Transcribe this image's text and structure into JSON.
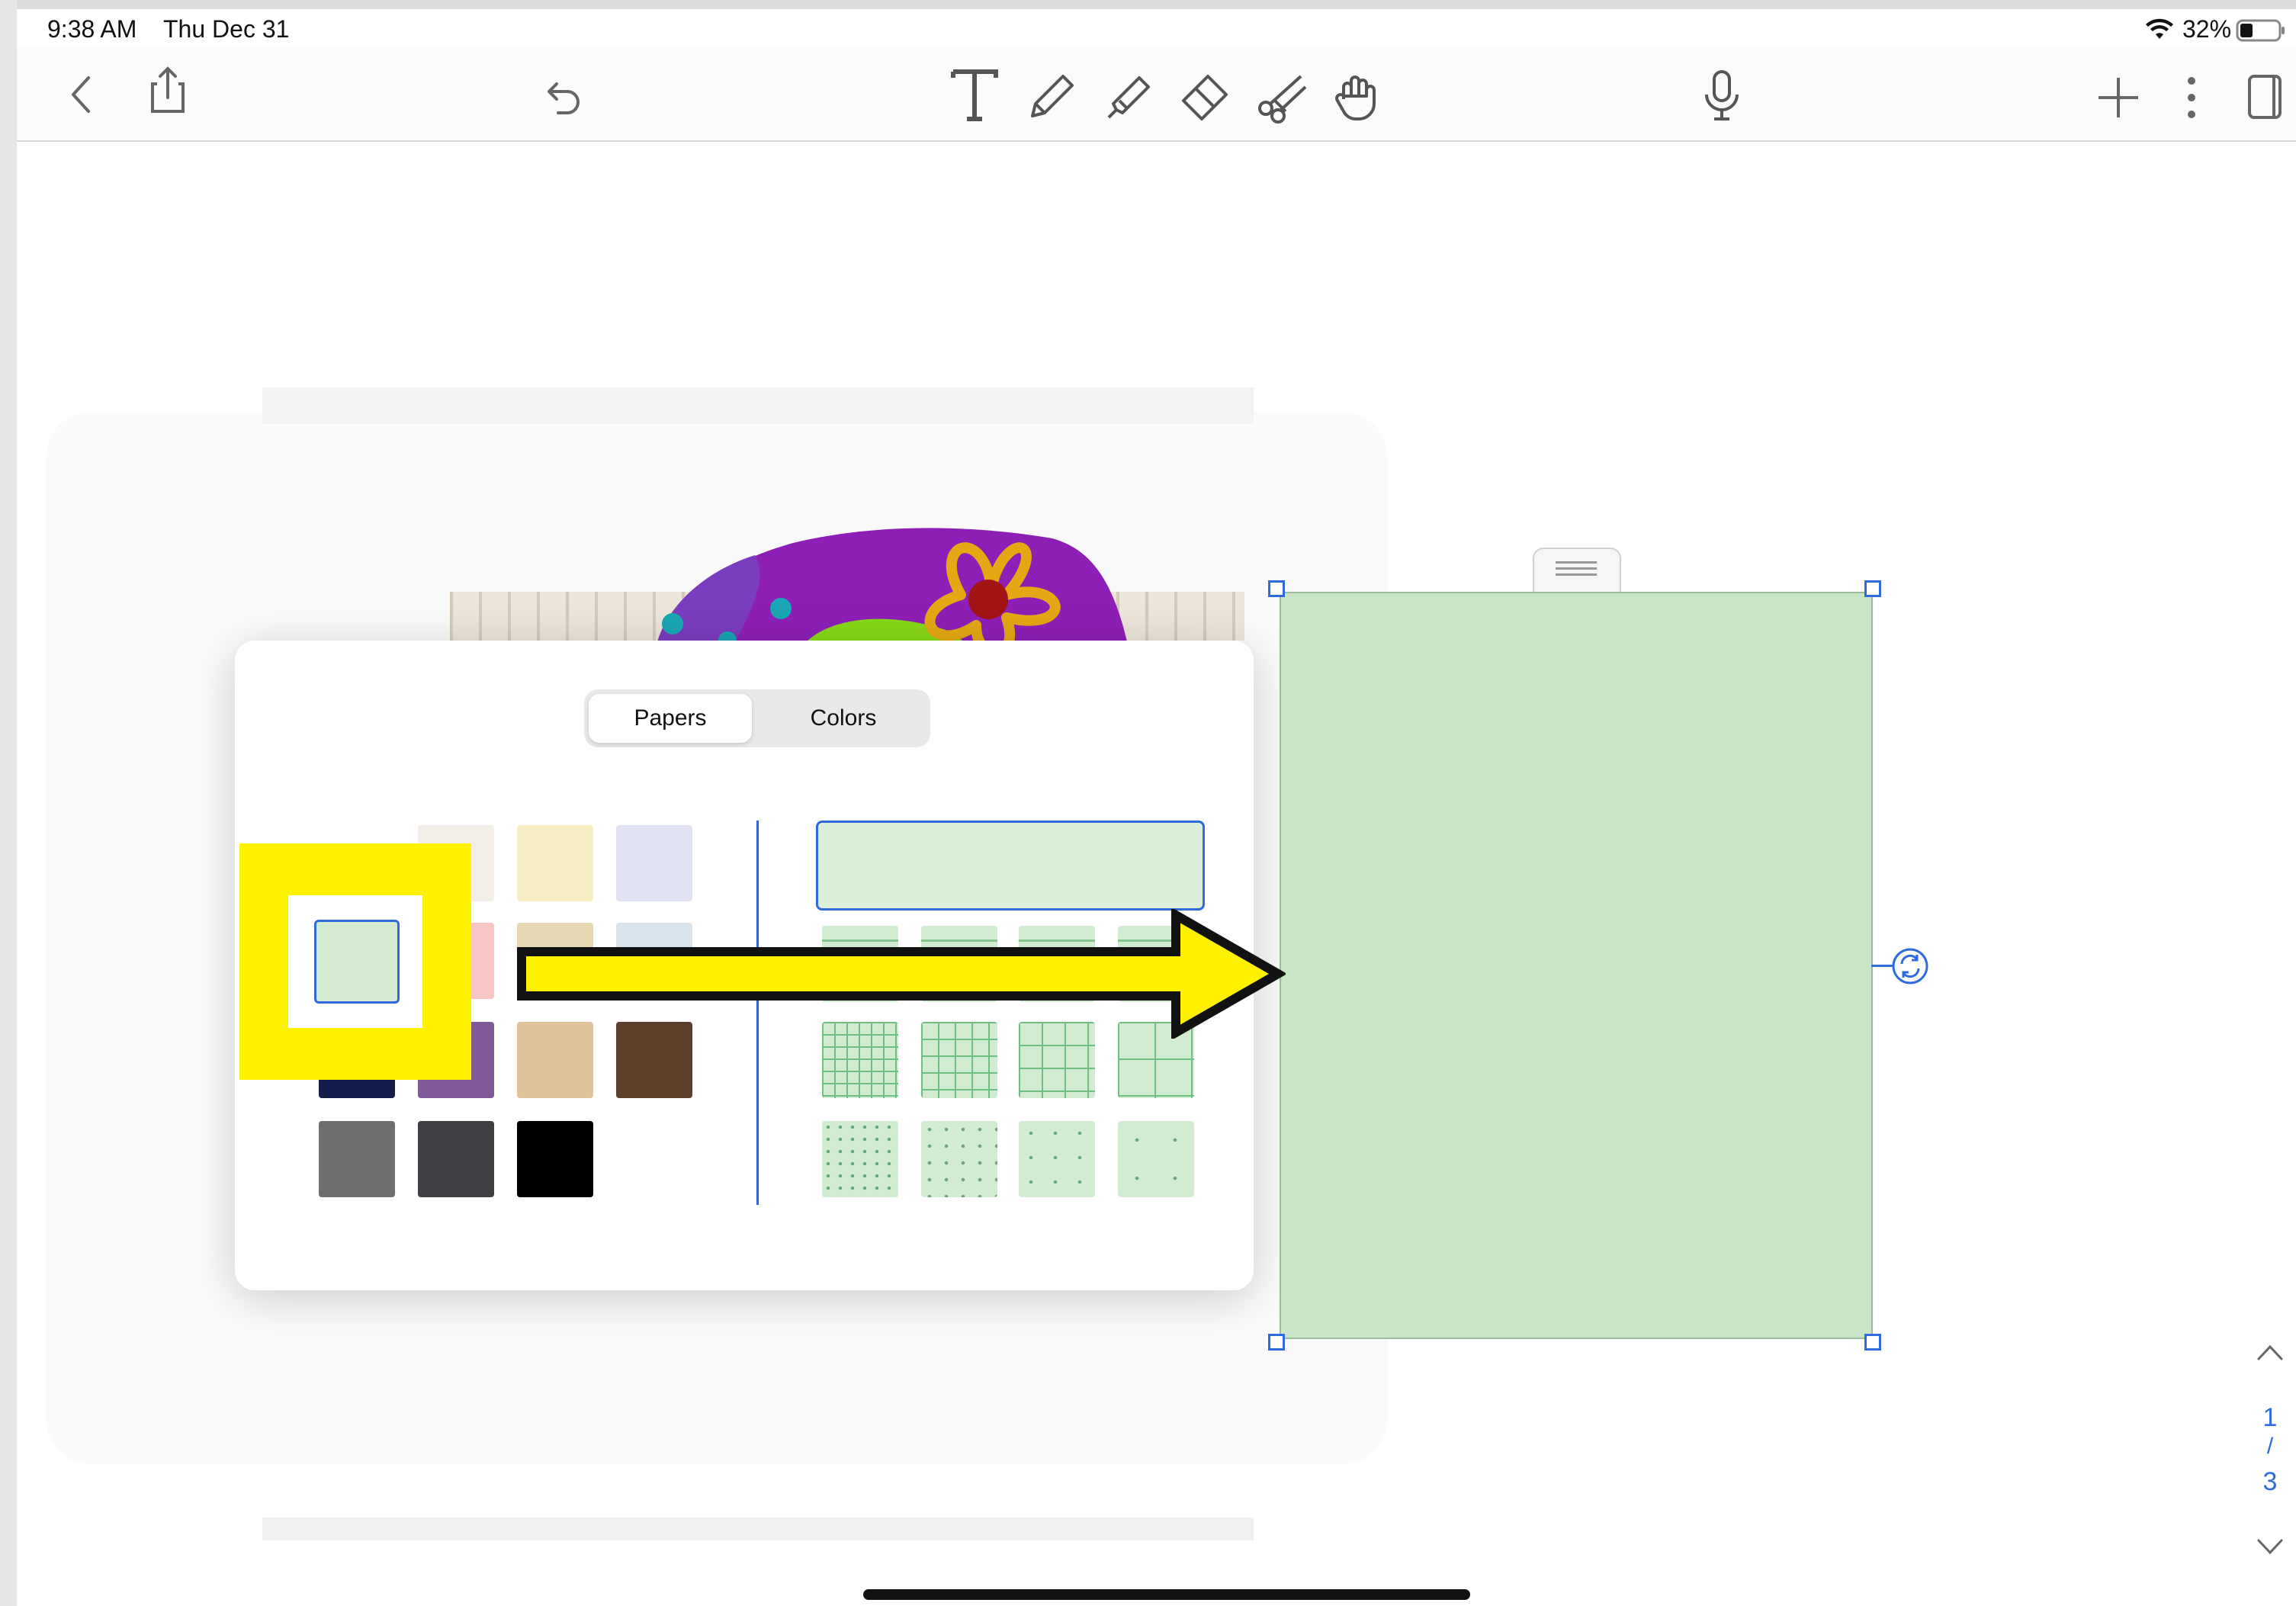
{
  "status_bar": {
    "time": "9:38 AM",
    "date": "Thu Dec 31",
    "battery_percent": "32%",
    "battery_level": 0.32
  },
  "toolbar": {
    "icons": [
      "back-chevron-icon",
      "share-icon",
      "undo-icon",
      "text-tool-icon",
      "pen-icon",
      "highlighter-icon",
      "eraser-icon",
      "scissors-icon",
      "hand-icon",
      "microphone-icon",
      "add-icon",
      "more-icon",
      "page-layout-icon"
    ]
  },
  "paper_picker": {
    "tabs": [
      {
        "label": "Papers",
        "selected": true
      },
      {
        "label": "Colors",
        "selected": false
      }
    ],
    "paper_colors": [
      "#f3efe8",
      "#f7eec3",
      "#e1e3f3",
      "#d5ecd2",
      "#f7c6c2",
      "#e8d7b4",
      "#d9e3ec",
      "#131c4a",
      "#7f5a96",
      "#e2c29b",
      "#5e3f2c",
      "#6f6f6f",
      "#3f3f44",
      "#000000"
    ],
    "selected_color": "#d5ecd2",
    "patterns": [
      "blank",
      "lined",
      "lined",
      "lined",
      "lined",
      "grid",
      "grid",
      "grid",
      "grid",
      "dots",
      "dots",
      "dots",
      "dots"
    ]
  },
  "canvas": {
    "selected_paper_color": "#c9e6c7"
  },
  "annotation": {
    "highlight_color": "#fff200",
    "arrow_color": "#fff200"
  },
  "page_indicator": {
    "current": "1",
    "separator": "/",
    "total": "3"
  }
}
